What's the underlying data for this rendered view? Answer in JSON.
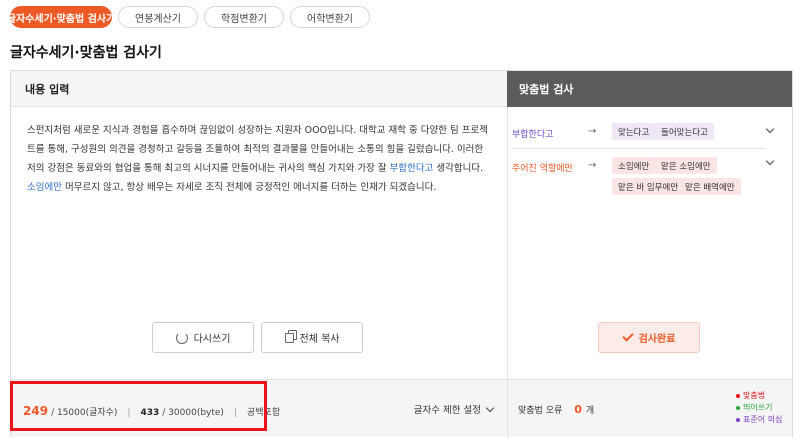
{
  "tabs": [
    {
      "label": "글자수세기·맞춤법 검사기",
      "active": true
    },
    {
      "label": "연봉계산기",
      "active": false
    },
    {
      "label": "학점변환기",
      "active": false
    },
    {
      "label": "어학변환기",
      "active": false
    }
  ],
  "page_title": "글자수세기·맞춤법 검사기",
  "left_panel": {
    "header": "내용 입력",
    "text_parts": [
      "스펀지처럼 새로운 지식과 경험을 흡수하며 끊임없이 성장하는 지원자 OOO입니다. 대학교 재학 중 다양한 팀 프로젝트를 통해, 구성원의 의견을 경청하고 갈등을 조율하여 최적의 결과물을 만들어내는 소통의 힘을 길렀습니다. 이러한 저의 강점은 동료와의 협업을 통해 최고의 시너지를 만들어내는 귀사의 핵심 가치와 가장 잘 ",
      "부합한다고",
      " 생각합니다. ",
      "소임에만",
      " 머무르지 않고, 항상 배우는 자세로 조직 전체에 긍정적인 에너지를 더하는 인재가 되겠습니다."
    ],
    "reset_label": "다시쓰기",
    "copy_label": "전체 복사",
    "char_count": "249",
    "char_total": "/ 15000(글자수)",
    "byte_count": "433",
    "byte_total": "/ 30000(byte)",
    "space_label": "공백포함",
    "limit_label": "글자수 제한 설정"
  },
  "right_panel": {
    "header": "맞춤법 검사",
    "suggestions": [
      {
        "original": "부합한다고",
        "options": [
          "맞는다고",
          "들어맞는다고"
        ]
      },
      {
        "original": "주어진 역할에만",
        "options": [
          "소임에만",
          "맡은 소임에만",
          "맡은 바 임무에만",
          "맡은 배역에만"
        ]
      }
    ],
    "check_label": "검사완료",
    "error_label": "맞춤법 오류",
    "error_count": "0",
    "error_unit": "개",
    "legend": [
      {
        "label": "맞춤법",
        "color": "#e8141a"
      },
      {
        "label": "띄어쓰기",
        "color": "#2aa73a"
      },
      {
        "label": "표준어 의심",
        "color": "#7b3fc4"
      }
    ]
  }
}
